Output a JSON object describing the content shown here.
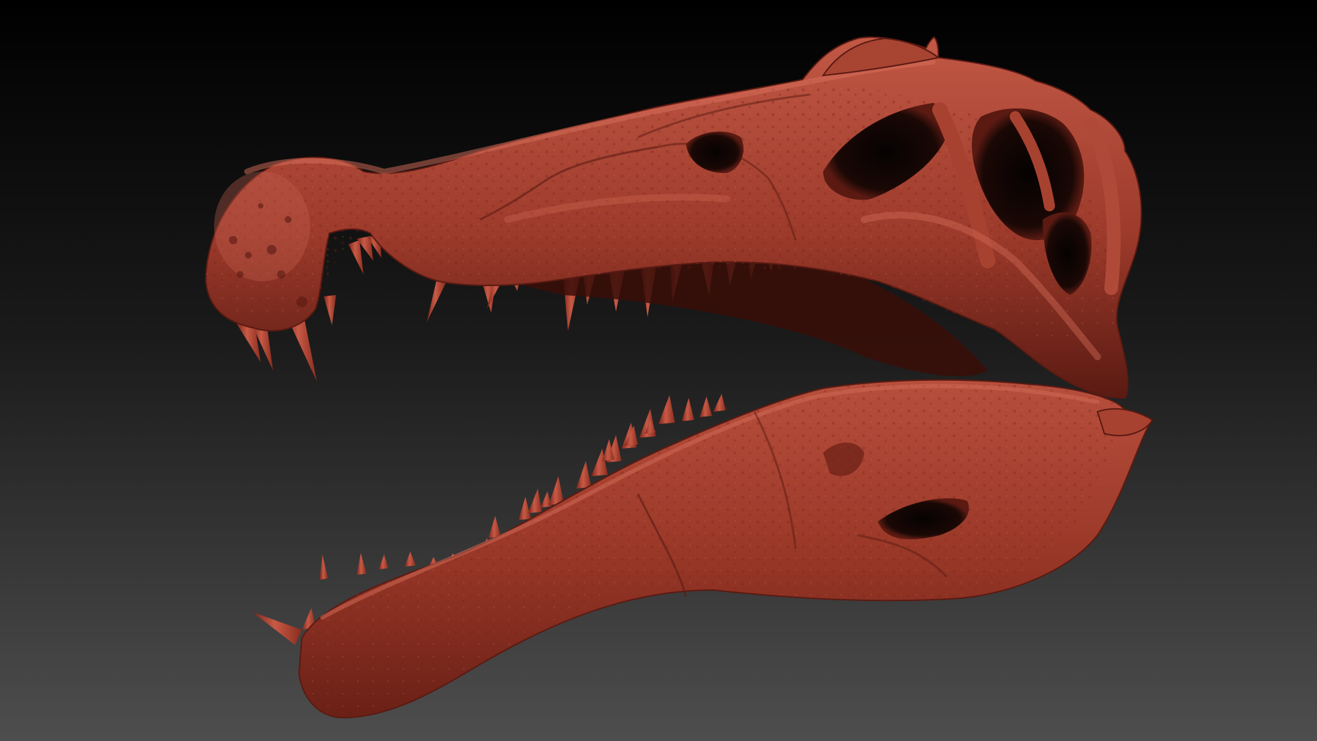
{
  "scene": {
    "subject": "spinosaurus-skull-sculpt",
    "material_color": "#a03a2c",
    "material_highlight": "#c65a48",
    "material_shadow": "#4a140e",
    "tooth_color": "#b24a38",
    "background_top": "#000000",
    "background_bottom": "#4e4e4e"
  }
}
